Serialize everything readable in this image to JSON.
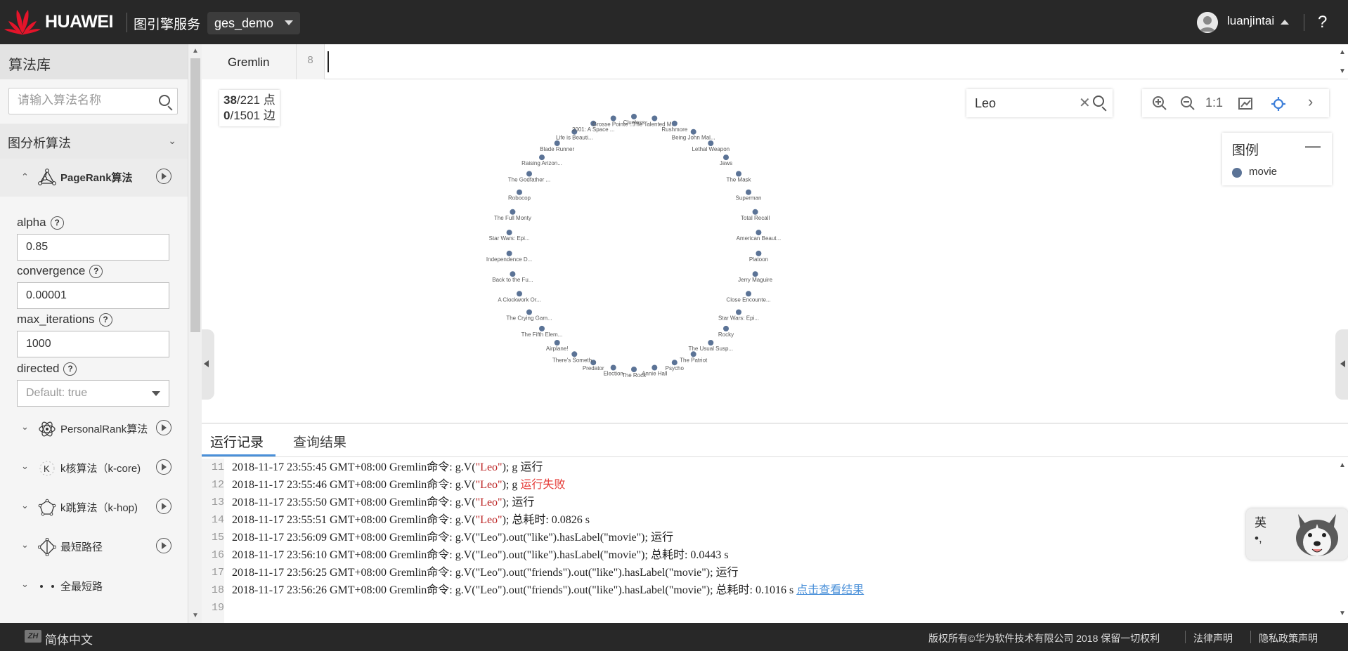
{
  "header": {
    "brand": "HUAWEI",
    "service": "图引擎服务",
    "project": "ges_demo",
    "user": "luanjintai",
    "help": "?"
  },
  "sidebar": {
    "title": "算法库",
    "search_placeholder": "请输入算法名称",
    "category": "图分析算法",
    "pagerank": {
      "label": "PageRank算法",
      "params": [
        {
          "name": "alpha",
          "value": "0.85"
        },
        {
          "name": "convergence",
          "value": "0.00001"
        },
        {
          "name": "max_iterations",
          "value": "1000"
        }
      ],
      "directed_label": "directed",
      "directed_placeholder": "Default: true"
    },
    "algorithms": [
      {
        "label": "PersonalRank算法",
        "icon": "atom-icon"
      },
      {
        "label": "k核算法（k-core)",
        "icon": "k-icon"
      },
      {
        "label": "k跳算法（k-hop)",
        "icon": "pentagon-icon"
      },
      {
        "label": "最短路径",
        "icon": "diamond-path-icon"
      },
      {
        "label": "全最短路",
        "icon": "dots-icon"
      }
    ]
  },
  "editor": {
    "tab": "Gremlin",
    "line_number": "8"
  },
  "graph": {
    "node_count": "38",
    "node_total": "/221 点",
    "edge_count": "0",
    "edge_total": "/1501 边",
    "search_value": "Leo",
    "zoom_reset": "1:1",
    "legend_title": "图例",
    "legend_minimize": "—",
    "legend_item": "movie",
    "node_color": "#5b7396",
    "nodes": [
      "Clueless",
      "The Talented M...",
      "Rushmore",
      "Being John Mal...",
      "Lethal Weapon",
      "Jaws",
      "The Mask",
      "Superman",
      "Total Recall",
      "American Beaut...",
      "Platoon",
      "Jerry Maguire",
      "Close Encounte...",
      "Star Wars: Epi...",
      "Rocky",
      "The Usual Susp...",
      "The Patriot",
      "Psycho",
      "Annie Hall",
      "The Rock",
      "Election",
      "Predator",
      "There's Someth...",
      "Airplane!",
      "The Fifth Elem...",
      "The Crying Gam...",
      "A Clockwork Or...",
      "Back to the Fu...",
      "Independence D...",
      "Star Wars: Epi...",
      "The Full Monty",
      "Robocop",
      "The Godfather ...",
      "Raising Arizon...",
      "Blade Runner",
      "Life is Beauti...",
      "2001: A Space ...",
      "Grosse Pointe ..."
    ]
  },
  "log": {
    "tabs": [
      "运行记录",
      "查询结果"
    ],
    "lines": [
      {
        "no": "11",
        "pre": "2018-11-17 23:55:45 GMT+08:00 Gremlin命令: g.V(",
        "str": "\"Leo\"",
        "post": "); g 运行",
        "extra": "",
        "link": ""
      },
      {
        "no": "12",
        "pre": "2018-11-17 23:55:46 GMT+08:00 Gremlin命令: g.V(",
        "str": "\"Leo\"",
        "post": "); g ",
        "extra": "运行失败",
        "link": ""
      },
      {
        "no": "13",
        "pre": "2018-11-17 23:55:50 GMT+08:00 Gremlin命令: g.V(",
        "str": "\"Leo\"",
        "post": "); 运行",
        "extra": "",
        "link": ""
      },
      {
        "no": "14",
        "pre": "2018-11-17 23:55:51 GMT+08:00 Gremlin命令: g.V(",
        "str": "\"Leo\"",
        "post": "); 总耗时: 0.0826 s",
        "extra": "",
        "link": ""
      },
      {
        "no": "15",
        "pre": "2018-11-17 23:56:09 GMT+08:00 Gremlin命令: g.V(\"Leo\").out(\"like\").hasLabel(\"movie\"); 运行",
        "str": "",
        "post": "",
        "extra": "",
        "link": ""
      },
      {
        "no": "16",
        "pre": "2018-11-17 23:56:10 GMT+08:00 Gremlin命令: g.V(\"Leo\").out(\"like\").hasLabel(\"movie\"); 总耗时: 0.0443 s",
        "str": "",
        "post": "",
        "extra": "",
        "link": ""
      },
      {
        "no": "17",
        "pre": "2018-11-17 23:56:25 GMT+08:00 Gremlin命令: g.V(\"Leo\").out(\"friends\").out(\"like\").hasLabel(\"movie\"); 运行",
        "str": "",
        "post": "",
        "extra": "",
        "link": ""
      },
      {
        "no": "18",
        "pre": "2018-11-17 23:56:26 GMT+08:00 Gremlin命令: g.V(\"Leo\").out(\"friends\").out(\"like\").hasLabel(\"movie\"); 总耗时: 0.1016 s ",
        "str": "",
        "post": "",
        "extra": "",
        "link": "点击查看结果"
      },
      {
        "no": "19",
        "pre": "",
        "str": "",
        "post": "",
        "extra": "",
        "link": ""
      }
    ]
  },
  "ime": {
    "char": "英",
    "punct": "•,"
  },
  "footer": {
    "lang_icon": "ZH",
    "lang": "简体中文",
    "copyright": "版权所有©华为软件技术有限公司 2018 保留一切权利",
    "legal": "法律声明",
    "privacy": "隐私政策声明"
  }
}
